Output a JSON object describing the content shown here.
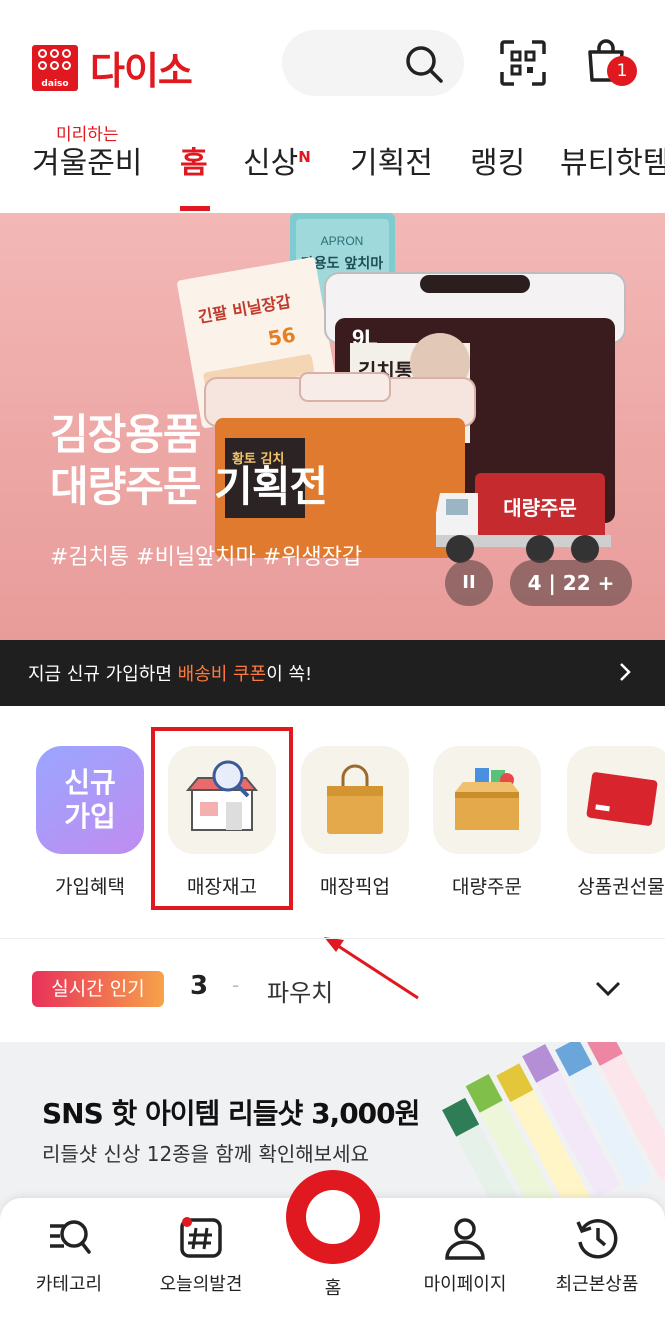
{
  "header": {
    "logo_text": "다이소",
    "logo_sub": "daiso",
    "cart_count": "1"
  },
  "tabs": {
    "items": [
      {
        "label": "겨울준비",
        "sup": "미리하는"
      },
      {
        "label": "홈"
      },
      {
        "label": "신상",
        "badge": "N"
      },
      {
        "label": "기획전"
      },
      {
        "label": "랭킹"
      },
      {
        "label": "뷰티핫템"
      }
    ],
    "active_index": 1
  },
  "banner": {
    "title_line1": "김장용품",
    "title_line2": "대량주문 기획전",
    "tags": "#김치통 #비닐앞치마 #위생장갑",
    "pause_label": "II",
    "counter": "4 | 22 +",
    "product_texts": {
      "apron_brand": "APRON",
      "apron_name": "다용도 앞치마",
      "glove_name": "긴팔 비닐장갑",
      "glove_count": "56",
      "container_size": "9L",
      "container_name": "김치통",
      "small_container_name": "황토 김치",
      "truck_label": "대량주문"
    }
  },
  "strip": {
    "text_before": "지금 신규 가입하면 ",
    "text_highlight": "배송비 쿠폰",
    "text_after": "이 쏙!"
  },
  "quick_menu": {
    "items": [
      {
        "label": "가입혜택",
        "icon_text_line1": "신규",
        "icon_text_line2": "가입"
      },
      {
        "label": "매장재고"
      },
      {
        "label": "매장픽업"
      },
      {
        "label": "대량주문"
      },
      {
        "label": "상품권선물"
      }
    ]
  },
  "realtime": {
    "badge": "실시간 인기",
    "rank": "3",
    "dash": "-",
    "keyword": "파우치"
  },
  "promo": {
    "title": "SNS 핫 아이템 리들샷 3,000원",
    "subtitle": "리들샷 신상 12종을 함께 확인해보세요"
  },
  "bottom_nav": {
    "items": [
      {
        "label": "카테고리"
      },
      {
        "label": "오늘의발견"
      },
      {
        "label": "홈"
      },
      {
        "label": "마이페이지"
      },
      {
        "label": "최근본상품"
      }
    ]
  },
  "colors": {
    "brand": "#e0181f",
    "strip_highlight": "#ff7a3d",
    "annotation": "#e0181f"
  }
}
